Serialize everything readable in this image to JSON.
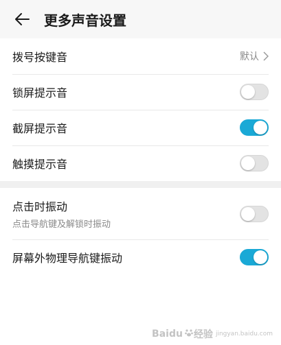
{
  "header": {
    "title": "更多声音设置",
    "back_icon": "arrow-left-icon"
  },
  "group1": [
    {
      "label": "拨号按键音",
      "type": "value",
      "value": "默认"
    },
    {
      "label": "锁屏提示音",
      "type": "toggle",
      "on": false
    },
    {
      "label": "截屏提示音",
      "type": "toggle",
      "on": true
    },
    {
      "label": "触摸提示音",
      "type": "toggle",
      "on": false
    }
  ],
  "group2": [
    {
      "label": "点击时振动",
      "sub": "点击导航键及解锁时振动",
      "type": "toggle",
      "on": false
    },
    {
      "label": "屏幕外物理导航键振动",
      "type": "toggle",
      "on": true
    }
  ],
  "colors": {
    "accent": "#1aa9d6",
    "toggle_off": "#e3e3e3"
  },
  "watermark": {
    "brand": "Baidu",
    "sub": "经验",
    "site": "jingyan.baidu.com"
  }
}
